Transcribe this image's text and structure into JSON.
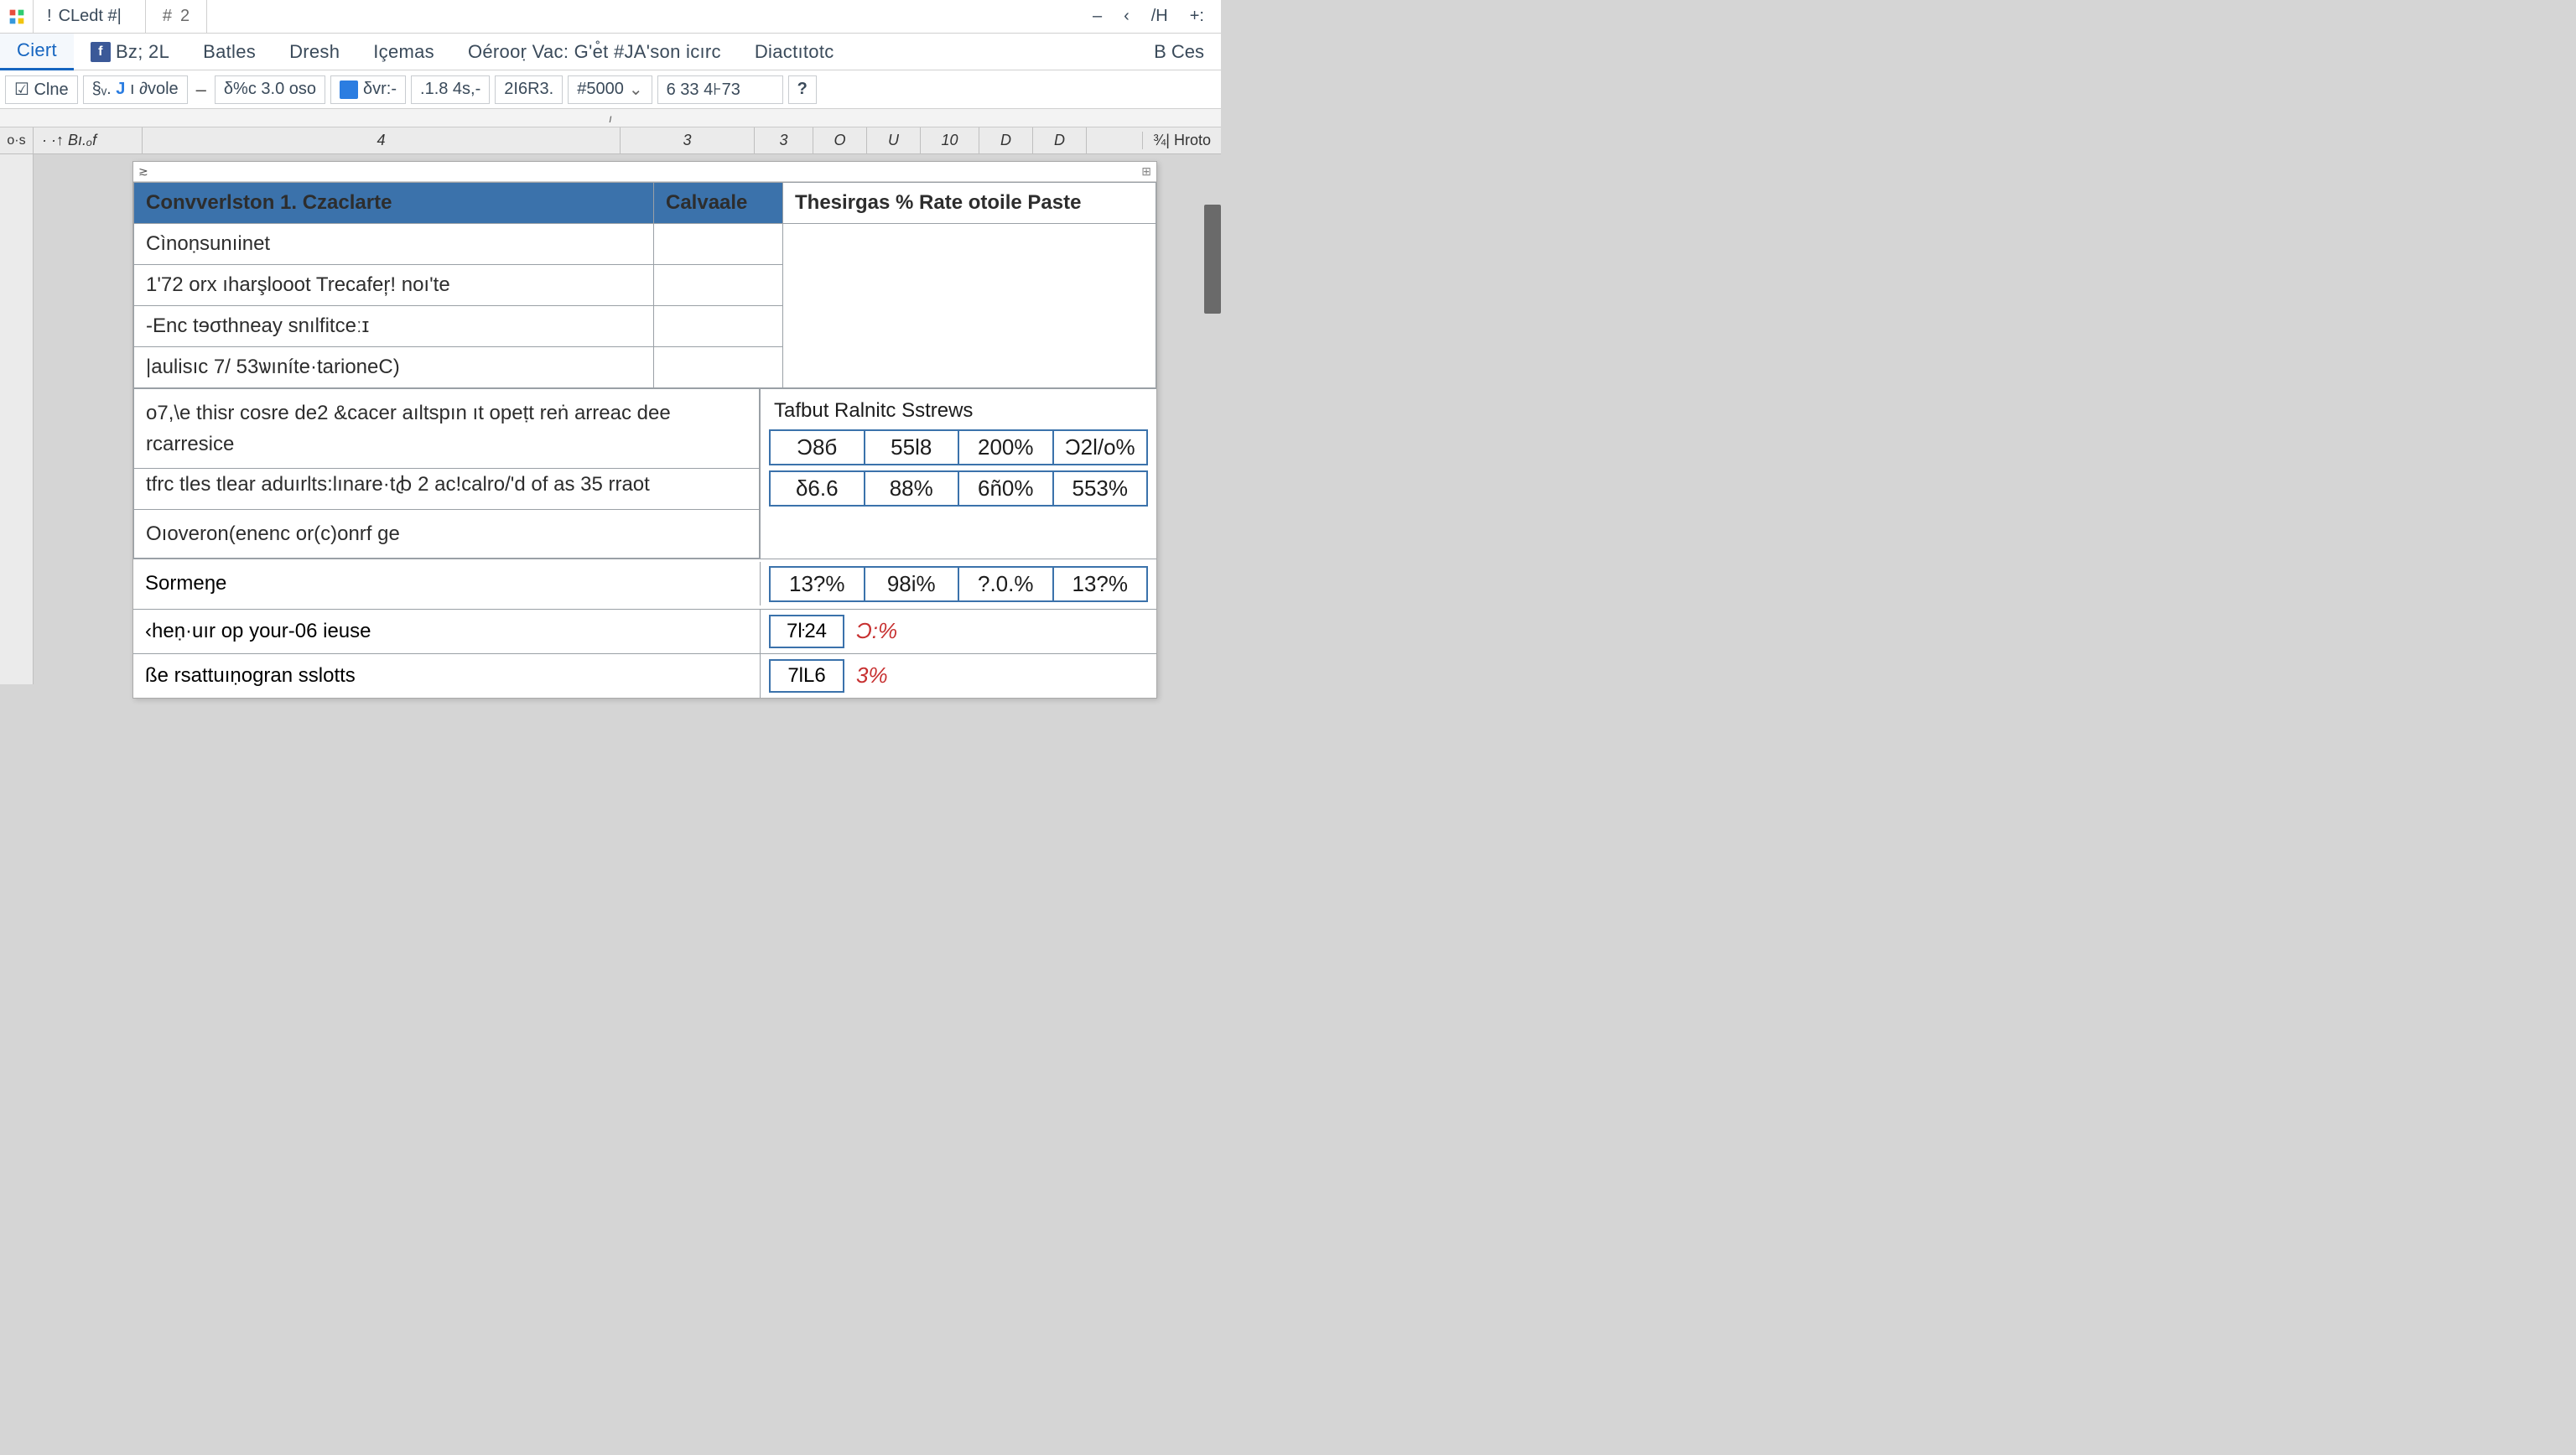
{
  "titlebar": {
    "doc_tab_sep": "!",
    "doc_tab_label": "CLedt  #|",
    "tab2_hash": "#",
    "tab2_num": "2",
    "win_controls": [
      "–",
      "‹",
      "/H",
      "+:"
    ]
  },
  "ribbon": {
    "tabs": [
      "Ciert",
      "Bz; 2L",
      "Batles",
      "Dresh",
      "Içemas",
      "Oérooṛ Vac: G'e̊t  #JA'son icırc",
      "Diactıtotc"
    ],
    "fb_prefix": "f",
    "right": "B Ces"
  },
  "formula": {
    "seg1": "☑ Clne",
    "seg2_icon": "§ᵥ.",
    "seg2_j": "J",
    "seg2_text": "ı ∂vole",
    "dash": "–",
    "seg3": "δ%c  3.0  oso",
    "seg4": "δvr:-",
    "seg5": ".1.8  4s,-",
    "seg6": "2I6R3.",
    "seg7": "#5000",
    "seg8": "6 33 4⊦73",
    "help": "?"
  },
  "ruler_mark": "ı",
  "colheads": {
    "corner": "o·s",
    "left_label": "·  ·↑ Bı.ₒf",
    "cols": [
      "4",
      "3",
      "3",
      "O",
      "U",
      "10",
      "D",
      "D"
    ],
    "right": "¾| Hroto"
  },
  "panel": {
    "tl": "≳",
    "tr": "⊞",
    "header": {
      "c1": "Convverlston 1. Czaclarte",
      "c2": "Calvaale",
      "c3": "Thesirgas % Rate otoile Paste"
    },
    "rows_simple": [
      "Cìnoṇsunıinet",
      "1'72 orx ıharşlooot Trecafer̦! noı'te",
      "-Еnс tɘσthneay  ѕnılfitсеːɪ",
      "|аulіѕıc 7/ 53ѡınítе·tarioneC)"
    ],
    "desc_block": {
      "line1": "o7,\\e thisr cosre de2 &cacer aıltspın ıt opeṭt reṅ arreac dee rcarresice",
      "line2": "tfrc tles tlear aduırlts:lınare·tꞗ 2 ac!calro/'d of as 35 rraot",
      "line3": "Oıoveron(enenc or(c)onrf ge"
    },
    "right_label": "Tafbut Rаlnitc Sstrews",
    "mini_rows": [
      [
        "Ͻ8б",
        "55l8",
        "200%",
        "Ɔ2l/о%"
      ],
      [
        "δ6.6",
        "88%",
        "6ñ0%",
        "553%"
      ]
    ],
    "sormere": {
      "label": "Sormeŋe",
      "vals": [
        "13?%",
        "98i%",
        "?.0.%",
        "13?%"
      ]
    },
    "bottom_rows": [
      {
        "label": "‹heṇ·uır op yоur-06 ieuse",
        "box": "7ŀ24",
        "pct": "Ɔ:%"
      },
      {
        "label": "ßе rsattuıṇоgran ѕslotts",
        "box": "7lL6",
        "pct": "3%"
      }
    ]
  }
}
